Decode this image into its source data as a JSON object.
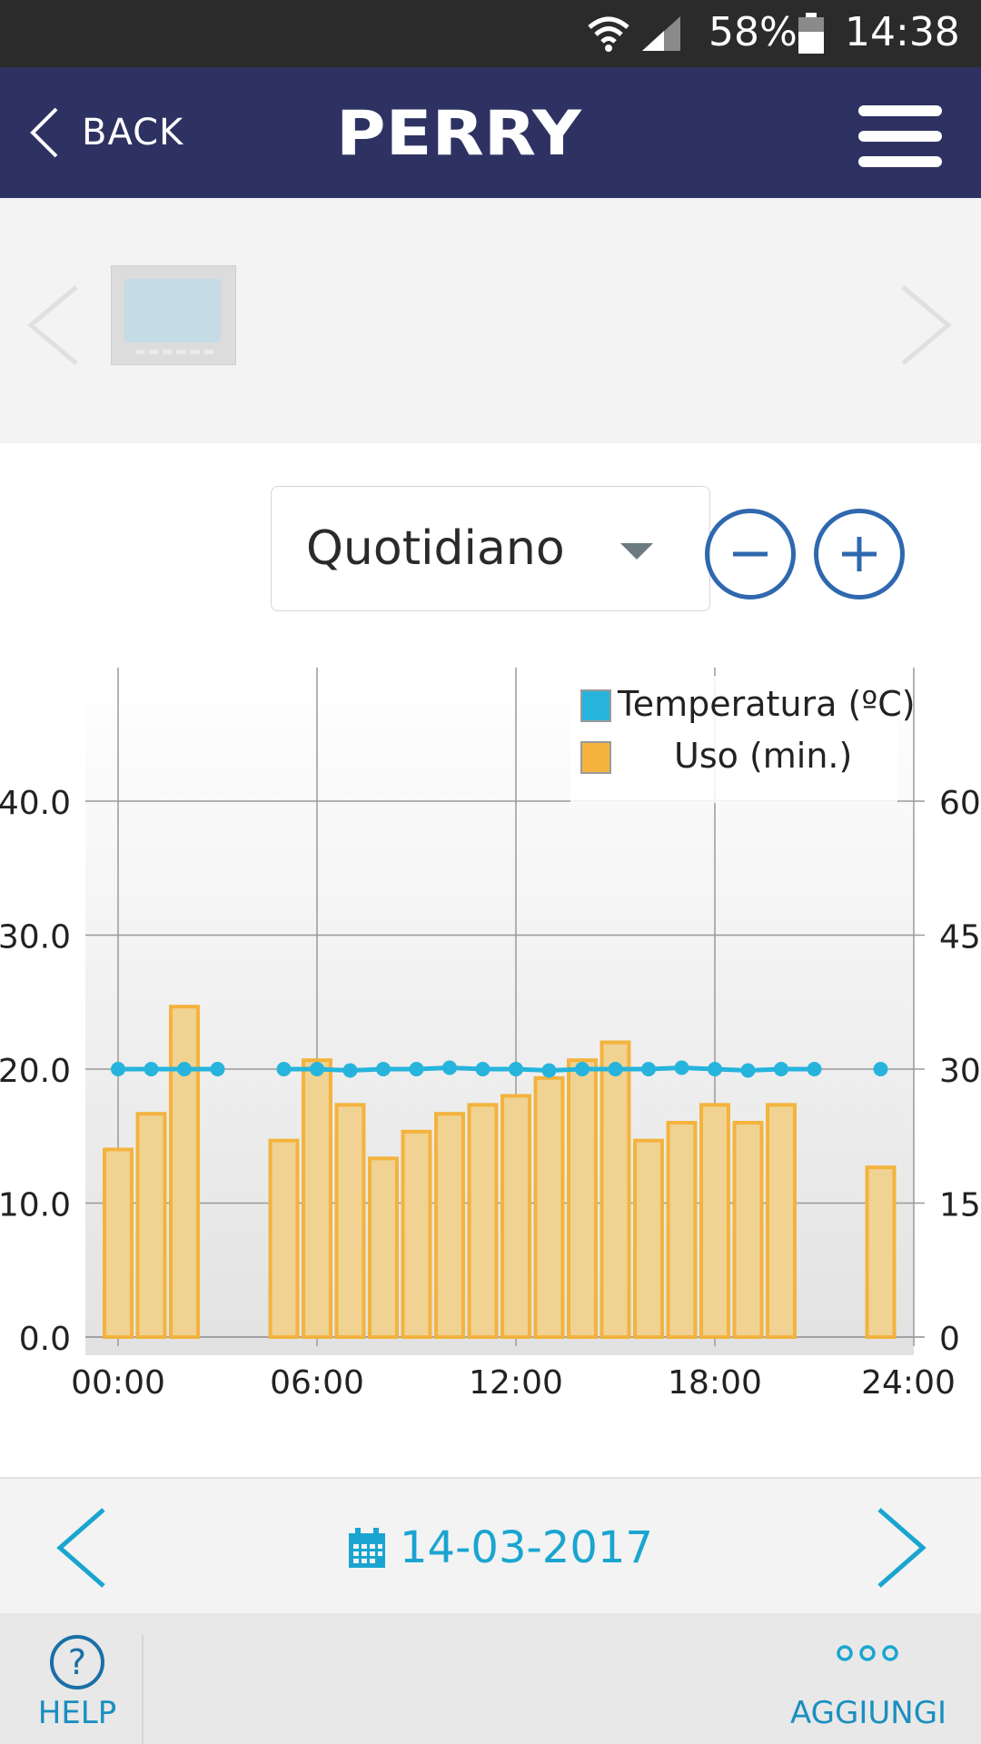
{
  "status_bar": {
    "battery": "58%",
    "time": "14:38"
  },
  "app_bar": {
    "back_label": "BACK",
    "logo_text": "PERRY"
  },
  "period": {
    "selected": "Quotidiano"
  },
  "chart_data": {
    "type": "bar+line",
    "legend": [
      "Temperatura (ºC)",
      "Uso (min.)"
    ],
    "x_ticks": [
      "00:00",
      "06:00",
      "12:00",
      "18:00",
      "24:00"
    ],
    "y_left_ticks": [
      "0.0",
      "10.0",
      "20.0",
      "30.0",
      "40.0"
    ],
    "y_right_ticks": [
      "0",
      "15",
      "30",
      "45",
      "60"
    ],
    "y_left_range": [
      0,
      40
    ],
    "y_right_range": [
      0,
      60
    ],
    "x_range_hours": [
      0,
      24
    ],
    "series": [
      {
        "name": "Uso (min.)",
        "type": "bar",
        "axis": "right",
        "color": "#f3b33d",
        "points": [
          {
            "h": 0,
            "v": 21
          },
          {
            "h": 1,
            "v": 25
          },
          {
            "h": 2,
            "v": 37
          },
          {
            "h": 5,
            "v": 22
          },
          {
            "h": 6,
            "v": 31
          },
          {
            "h": 7,
            "v": 26
          },
          {
            "h": 8,
            "v": 20
          },
          {
            "h": 9,
            "v": 23
          },
          {
            "h": 10,
            "v": 25
          },
          {
            "h": 11,
            "v": 26
          },
          {
            "h": 12,
            "v": 27
          },
          {
            "h": 13,
            "v": 29
          },
          {
            "h": 14,
            "v": 31
          },
          {
            "h": 15,
            "v": 33
          },
          {
            "h": 16,
            "v": 22
          },
          {
            "h": 17,
            "v": 24
          },
          {
            "h": 18,
            "v": 26
          },
          {
            "h": 19,
            "v": 24
          },
          {
            "h": 20,
            "v": 26
          },
          {
            "h": 23,
            "v": 19
          }
        ]
      },
      {
        "name": "Temperatura (ºC)",
        "type": "line",
        "axis": "left",
        "color": "#26b4dc",
        "segments": [
          [
            {
              "h": 0,
              "v": 20
            },
            {
              "h": 1,
              "v": 20
            },
            {
              "h": 2,
              "v": 20
            },
            {
              "h": 3,
              "v": 20
            }
          ],
          [
            {
              "h": 5,
              "v": 20
            },
            {
              "h": 6,
              "v": 20
            },
            {
              "h": 7,
              "v": 19.9
            },
            {
              "h": 8,
              "v": 20
            },
            {
              "h": 9,
              "v": 20
            },
            {
              "h": 10,
              "v": 20.1
            },
            {
              "h": 11,
              "v": 20
            },
            {
              "h": 12,
              "v": 20
            },
            {
              "h": 13,
              "v": 19.9
            },
            {
              "h": 14,
              "v": 20
            },
            {
              "h": 15,
              "v": 20
            },
            {
              "h": 16,
              "v": 20
            },
            {
              "h": 17,
              "v": 20.1
            },
            {
              "h": 18,
              "v": 20
            },
            {
              "h": 19,
              "v": 19.9
            },
            {
              "h": 20,
              "v": 20
            },
            {
              "h": 21,
              "v": 20
            }
          ],
          [
            {
              "h": 23,
              "v": 20
            }
          ]
        ]
      }
    ]
  },
  "date_nav": {
    "date": "14-03-2017"
  },
  "footer": {
    "help_label": "HELP",
    "add_label": "AGGIUNGI"
  },
  "colors": {
    "header": "#2e3262",
    "accent": "#1aa5d0",
    "bar": "#f3b33d",
    "line": "#26b4dc",
    "zoom": "#2f68ae"
  }
}
